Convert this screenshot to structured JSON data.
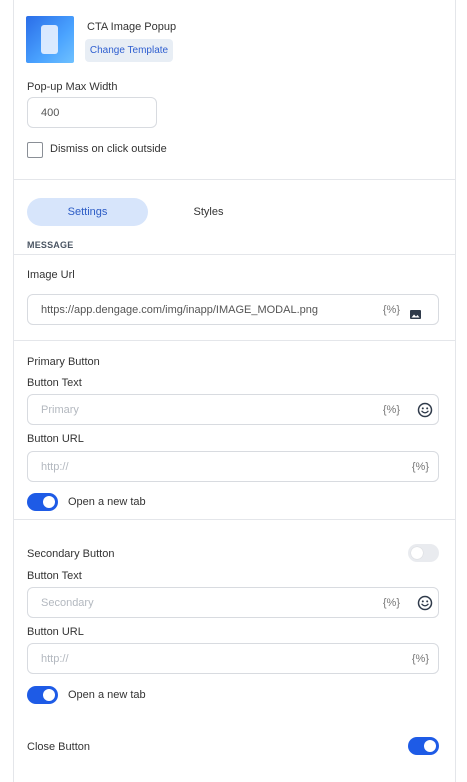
{
  "template": {
    "name": "CTA Image Popup",
    "change_label": "Change Template"
  },
  "popup": {
    "max_width_label": "Pop-up Max Width",
    "max_width_value": "400",
    "dismiss_label": "Dismiss on click outside"
  },
  "tabs": [
    "Settings",
    "Styles"
  ],
  "message_heading": "MESSAGE",
  "image": {
    "label": "Image Url",
    "value": "https://app.dengage.com/img/inapp/IMAGE_MODAL.png",
    "var_token": "{%}"
  },
  "primary": {
    "section_label": "Primary Button",
    "text_label": "Button Text",
    "text_placeholder": "Primary",
    "url_label": "Button URL",
    "url_placeholder": "http://",
    "var_token": "{%}",
    "new_tab_label": "Open a new tab"
  },
  "secondary": {
    "section_label": "Secondary Button",
    "text_label": "Button Text",
    "text_placeholder": "Secondary",
    "url_label": "Button URL",
    "url_placeholder": "http://",
    "var_token": "{%}",
    "new_tab_label": "Open a new tab"
  },
  "close_button_label": "Close Button",
  "colors": {
    "accent": "#1e5be6",
    "tab_active_bg": "#d7e5fb",
    "border": "#d8dbe0"
  },
  "icons": [
    "image-icon",
    "emoji-icon"
  ]
}
